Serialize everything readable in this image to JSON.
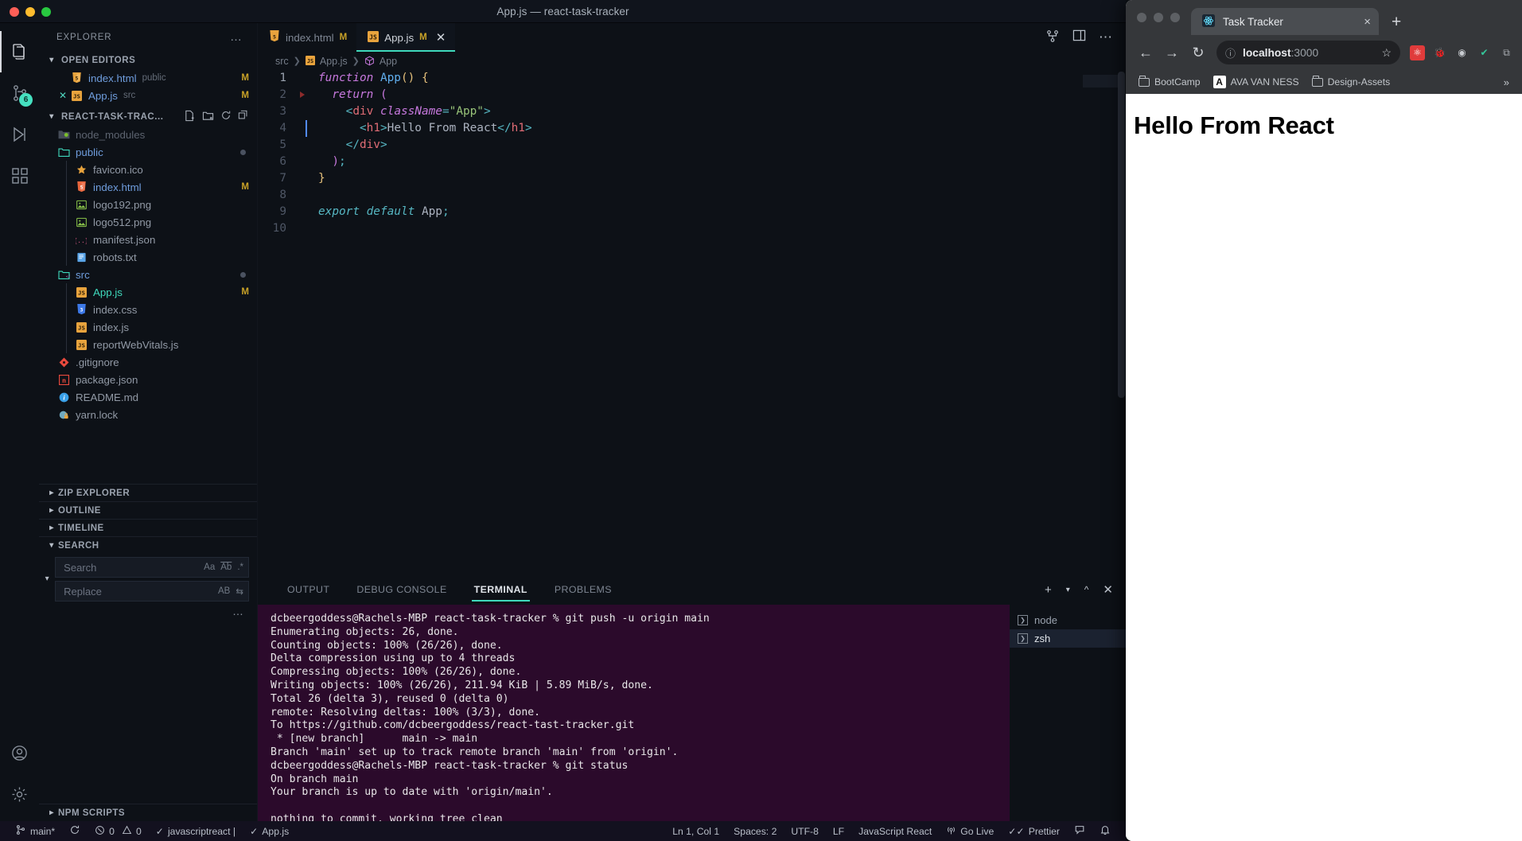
{
  "vscode": {
    "window_title": "App.js — react-task-tracker",
    "activity_bar": {
      "items": [
        {
          "name": "explorer",
          "icon": "files-icon",
          "badge": ""
        },
        {
          "name": "source-control",
          "icon": "source-control-icon",
          "badge": "6"
        },
        {
          "name": "run-debug",
          "icon": "run-debug-icon",
          "badge": ""
        },
        {
          "name": "extensions",
          "icon": "extensions-icon",
          "badge": ""
        }
      ],
      "bottom": [
        {
          "name": "accounts",
          "icon": "account-icon"
        },
        {
          "name": "settings",
          "icon": "gear-icon"
        }
      ]
    },
    "sidebar": {
      "title": "EXPLORER",
      "more_label": "…",
      "open_editors": {
        "label": "OPEN EDITORS",
        "items": [
          {
            "name": "index.html",
            "sub": "public",
            "badge": "M",
            "icon": "html-icon",
            "closable": false
          },
          {
            "name": "App.js",
            "sub": "src",
            "badge": "M",
            "icon": "js-icon",
            "closable": true
          }
        ]
      },
      "project": {
        "label": "REACT-TASK-TRAC...",
        "actions": [
          "new-file-icon",
          "new-folder-icon",
          "refresh-icon",
          "collapse-all-icon"
        ],
        "items": [
          {
            "name": "node_modules",
            "type": "folder",
            "icon": "node-folder-icon",
            "indent": 0,
            "dim": true
          },
          {
            "name": "public",
            "type": "folder",
            "icon": "folder-open-icon",
            "indent": 0,
            "modified_dot": true
          },
          {
            "name": "favicon.ico",
            "type": "file",
            "icon": "favicon-star-icon",
            "indent": 1
          },
          {
            "name": "index.html",
            "type": "file",
            "icon": "html-icon",
            "indent": 1,
            "badge": "M"
          },
          {
            "name": "logo192.png",
            "type": "file",
            "icon": "image-icon",
            "indent": 1
          },
          {
            "name": "logo512.png",
            "type": "file",
            "icon": "image-icon",
            "indent": 1
          },
          {
            "name": "manifest.json",
            "type": "file",
            "icon": "json-icon",
            "indent": 1
          },
          {
            "name": "robots.txt",
            "type": "file",
            "icon": "text-icon",
            "indent": 1
          },
          {
            "name": "src",
            "type": "folder",
            "icon": "src-folder-icon",
            "indent": 0,
            "modified_dot": true
          },
          {
            "name": "App.js",
            "type": "file",
            "icon": "js-icon",
            "indent": 1,
            "badge": "M",
            "selected": true
          },
          {
            "name": "index.css",
            "type": "file",
            "icon": "css-icon",
            "indent": 1
          },
          {
            "name": "index.js",
            "type": "file",
            "icon": "js-icon",
            "indent": 1
          },
          {
            "name": "reportWebVitals.js",
            "type": "file",
            "icon": "js-icon",
            "indent": 1
          },
          {
            "name": ".gitignore",
            "type": "file",
            "icon": "git-icon",
            "indent": 0
          },
          {
            "name": "package.json",
            "type": "file",
            "icon": "npm-icon",
            "indent": 0
          },
          {
            "name": "README.md",
            "type": "file",
            "icon": "info-icon",
            "indent": 0
          },
          {
            "name": "yarn.lock",
            "type": "file",
            "icon": "yarn-icon",
            "indent": 0
          }
        ]
      },
      "panels": [
        {
          "label": "ZIP EXPLORER",
          "expanded": false
        },
        {
          "label": "OUTLINE",
          "expanded": false
        },
        {
          "label": "TIMELINE",
          "expanded": false
        },
        {
          "label": "SEARCH",
          "expanded": true
        }
      ],
      "search": {
        "search_placeholder": "Search",
        "search_value": "",
        "replace_placeholder": "Replace",
        "replace_value": "",
        "match_case_label": "Aa",
        "whole_word_label": "Ab",
        "regex_label": ".*",
        "replace_all_label": "AB",
        "more_label": "…"
      },
      "npm_scripts": {
        "label": "NPM SCRIPTS",
        "expanded": false
      }
    },
    "editor": {
      "tabs": [
        {
          "label": "index.html",
          "icon": "html-icon",
          "badge": "M",
          "active": false,
          "closable": false
        },
        {
          "label": "App.js",
          "icon": "js-icon",
          "badge": "M",
          "active": true,
          "closable": true
        }
      ],
      "actions": [
        "split-editor-icon",
        "layout-icon",
        "more-actions-icon"
      ],
      "breadcrumb": [
        "src",
        "App.js",
        "App"
      ],
      "breadcrumb_icons": [
        "",
        "js-icon",
        "symbol-class-icon"
      ],
      "lines": [
        {
          "n": "1",
          "tokens": [
            {
              "t": "function ",
              "c": "k-kw"
            },
            {
              "t": "App",
              "c": "k-fn"
            },
            {
              "t": "()",
              "c": "k-par"
            },
            {
              "t": " ",
              "c": "k-id"
            },
            {
              "t": "{",
              "c": "k-brace"
            }
          ]
        },
        {
          "n": "2",
          "breakpoint": true,
          "tokens": [
            {
              "t": "  ",
              "c": "k-id"
            },
            {
              "t": "return",
              "c": "k-kw"
            },
            {
              "t": " ",
              "c": "k-id"
            },
            {
              "t": "(",
              "c": "k-punc"
            }
          ]
        },
        {
          "n": "3",
          "tokens": [
            {
              "t": "    ",
              "c": "k-id"
            },
            {
              "t": "<",
              "c": "k-br"
            },
            {
              "t": "div",
              "c": "k-tag"
            },
            {
              "t": " ",
              "c": "k-id"
            },
            {
              "t": "className",
              "c": "k-attr"
            },
            {
              "t": "=",
              "c": "k-br"
            },
            {
              "t": "\"App\"",
              "c": "k-str"
            },
            {
              "t": ">",
              "c": "k-br"
            }
          ]
        },
        {
          "n": "4",
          "cursor": true,
          "tokens": [
            {
              "t": "      ",
              "c": "k-id"
            },
            {
              "t": "<",
              "c": "k-br"
            },
            {
              "t": "h1",
              "c": "k-tag"
            },
            {
              "t": ">",
              "c": "k-br"
            },
            {
              "t": "Hello From React",
              "c": "k-txt"
            },
            {
              "t": "</",
              "c": "k-br"
            },
            {
              "t": "h1",
              "c": "k-tag"
            },
            {
              "t": ">",
              "c": "k-br"
            }
          ]
        },
        {
          "n": "5",
          "tokens": [
            {
              "t": "    ",
              "c": "k-id"
            },
            {
              "t": "</",
              "c": "k-br"
            },
            {
              "t": "div",
              "c": "k-tag"
            },
            {
              "t": ">",
              "c": "k-br"
            }
          ]
        },
        {
          "n": "6",
          "tokens": [
            {
              "t": "  ",
              "c": "k-id"
            },
            {
              "t": ")",
              "c": "k-punc"
            },
            {
              "t": ";",
              "c": "k-semi"
            }
          ]
        },
        {
          "n": "7",
          "tokens": [
            {
              "t": "}",
              "c": "k-brace"
            }
          ]
        },
        {
          "n": "8",
          "tokens": []
        },
        {
          "n": "9",
          "tokens": [
            {
              "t": "export default",
              "c": "k-exp"
            },
            {
              "t": " App",
              "c": "k-id"
            },
            {
              "t": ";",
              "c": "k-semi"
            }
          ]
        },
        {
          "n": "10",
          "tokens": []
        }
      ]
    },
    "panel": {
      "tabs": [
        {
          "label": "OUTPUT",
          "active": false
        },
        {
          "label": "DEBUG CONSOLE",
          "active": false
        },
        {
          "label": "TERMINAL",
          "active": true
        },
        {
          "label": "PROBLEMS",
          "active": false
        }
      ],
      "actions": [
        "new-terminal-icon",
        "chevron-down-icon",
        "maximize-panel-icon",
        "close-panel-icon"
      ],
      "terminal_lines": [
        "dcbeergoddess@Rachels-MBP react-task-tracker % git push -u origin main",
        "Enumerating objects: 26, done.",
        "Counting objects: 100% (26/26), done.",
        "Delta compression using up to 4 threads",
        "Compressing objects: 100% (26/26), done.",
        "Writing objects: 100% (26/26), 211.94 KiB | 5.89 MiB/s, done.",
        "Total 26 (delta 3), reused 0 (delta 0)",
        "remote: Resolving deltas: 100% (3/3), done.",
        "To https://github.com/dcbeergoddess/react-tast-tracker.git",
        " * [new branch]      main -> main",
        "Branch 'main' set up to track remote branch 'main' from 'origin'.",
        "dcbeergoddess@Rachels-MBP react-task-tracker % git status",
        "On branch main",
        "Your branch is up to date with 'origin/main'.",
        "",
        "nothing to commit, working tree clean"
      ],
      "terminal_prompt": "dcbeergoddess@Rachels-MBP react-task-tracker % ",
      "terminal_list": [
        {
          "label": "node",
          "selected": false
        },
        {
          "label": "zsh",
          "selected": true
        }
      ]
    },
    "statusbar": {
      "left": [
        {
          "name": "branch",
          "icon": "source-control-icon",
          "label": "main*"
        },
        {
          "name": "sync",
          "icon": "sync-icon",
          "label": ""
        },
        {
          "name": "problems",
          "icon": "error-icon",
          "label": "0",
          "icon2": "warning-icon",
          "label2": "0"
        },
        {
          "name": "javascriptreact",
          "icon": "check-icon",
          "label": "javascriptreact |"
        },
        {
          "name": "appjs-status",
          "icon": "check-icon",
          "label": "App.js"
        }
      ],
      "right": [
        {
          "name": "cursor-position",
          "label": "Ln 1, Col 1"
        },
        {
          "name": "indentation",
          "label": "Spaces: 2"
        },
        {
          "name": "encoding",
          "label": "UTF-8"
        },
        {
          "name": "eol",
          "label": "LF"
        },
        {
          "name": "language-mode",
          "label": "JavaScript React"
        },
        {
          "name": "go-live",
          "icon": "broadcast-icon",
          "label": "Go Live"
        },
        {
          "name": "prettier",
          "icon": "check-check-icon",
          "label": "Prettier"
        },
        {
          "name": "remote",
          "icon": "feedback-icon",
          "label": ""
        },
        {
          "name": "notifications",
          "icon": "bell-icon",
          "label": ""
        }
      ]
    }
  },
  "browser": {
    "tab": {
      "title": "Task Tracker",
      "favicon": "react-icon",
      "close_label": "×"
    },
    "new_tab_label": "+",
    "nav": {
      "back_label": "←",
      "forward_label": "→",
      "reload_label": "↻",
      "info_label": "ⓘ",
      "url_host": "localhost",
      "url_rest": ":3000",
      "star_label": "☆"
    },
    "extensions": [
      {
        "name": "react-devtools-icon",
        "glyph": "⚛",
        "bg": "#e03b3b",
        "fg": "#ffffff"
      },
      {
        "name": "bug-c-icon",
        "glyph": "🐞",
        "bg": "transparent",
        "fg": "#c9ccd1"
      },
      {
        "name": "screenshot-icon",
        "glyph": "◉",
        "bg": "transparent",
        "fg": "#c9ccd1"
      },
      {
        "name": "leaf-icon",
        "glyph": "✔",
        "bg": "transparent",
        "fg": "#35c79a"
      },
      {
        "name": "puzzle-icon",
        "glyph": "⧉",
        "bg": "transparent",
        "fg": "#a9adb3"
      }
    ],
    "bookmarks": [
      {
        "label": "BootCamp",
        "icon": "folder-icon"
      },
      {
        "label": "AVA VAN NESS",
        "icon": "ava-icon"
      },
      {
        "label": "Design-Assets",
        "icon": "folder-icon"
      }
    ],
    "bookmarks_overflow": "»",
    "page": {
      "heading": "Hello From React"
    }
  }
}
